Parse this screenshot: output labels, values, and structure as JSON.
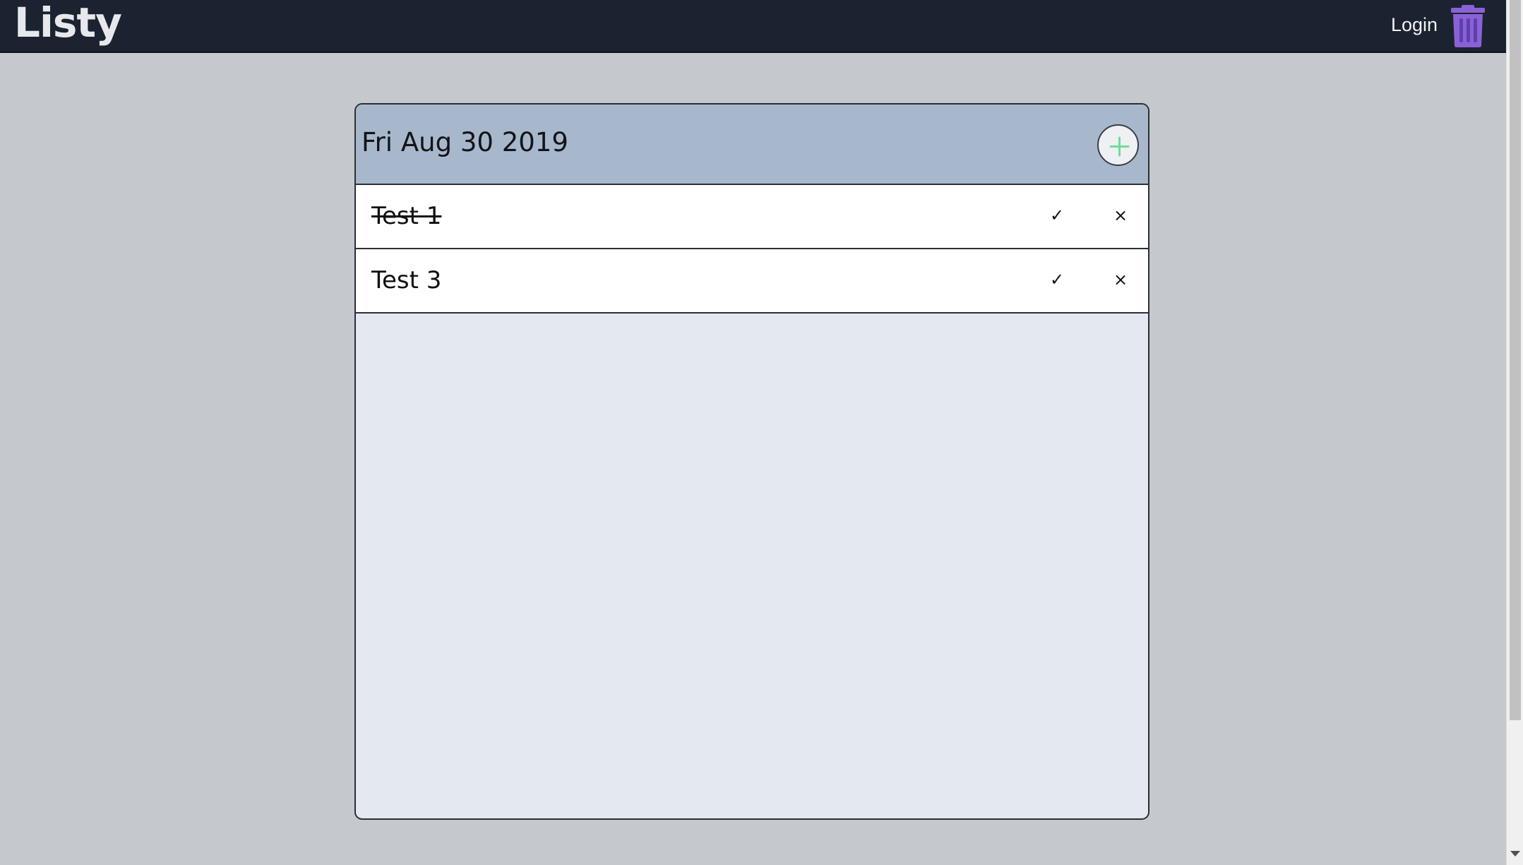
{
  "app": {
    "brand": "Listy",
    "login_label": "Login",
    "trash_icon": "trash-icon",
    "trash_color": "#8b62d6"
  },
  "card": {
    "title": "Fri Aug 30 2019",
    "add_icon": "plus-icon",
    "add_color": "#6fdc9a",
    "header_color": "#a8b8cc",
    "items": [
      {
        "label": "Test 1",
        "completed": true,
        "check_glyph": "✓",
        "delete_glyph": "×"
      },
      {
        "label": "Test 3",
        "completed": false,
        "check_glyph": "✓",
        "delete_glyph": "×"
      }
    ]
  }
}
